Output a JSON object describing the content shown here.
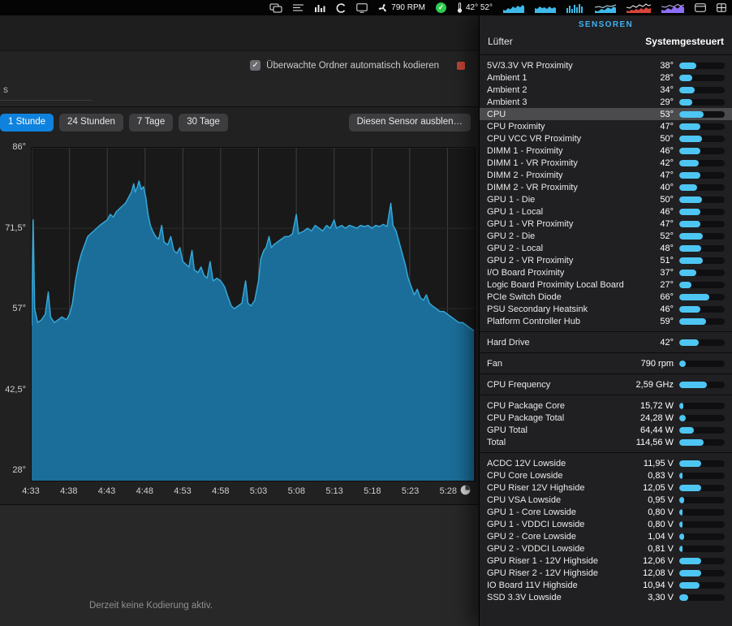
{
  "menubar": {
    "fan_rpm_label": "790 RPM",
    "temps_label": "42° 52°",
    "icons": [
      "displays-icon",
      "playlist-icon",
      "equalizer-icon",
      "c-app-icon",
      "display-icon",
      "fan-icon",
      "status-ok-icon",
      "thermometer-icon",
      "cpu-history-graph-icon",
      "gpu-history-graph-icon",
      "memory-history-graph-icon",
      "disk-history-graph-icon",
      "sensors-history-graph-icon",
      "network-history-graph-icon",
      "window-icon",
      "grid-icon"
    ]
  },
  "encoder_window": {
    "watch_checkbox_label": "Überwachte Ordner automatisch kodieren",
    "watch_checkbox_checked": true,
    "sidebar_stub": "s",
    "status_text": "Derzeit keine Kodierung aktiv.",
    "hide_sensor_button_label": "Diesen Sensor ausblen…",
    "range_tabs": [
      {
        "label": "1 Stunde",
        "selected": true
      },
      {
        "label": "24 Stunden",
        "selected": false
      },
      {
        "label": "7 Tage",
        "selected": false
      },
      {
        "label": "30 Tage",
        "selected": false
      }
    ]
  },
  "chart_data": {
    "type": "area",
    "sensor": "CPU",
    "unit": "°C",
    "y_range": [
      26,
      86
    ],
    "x_range_minutes": [
      0,
      58.6
    ],
    "grid": true,
    "y_ticks": [
      {
        "label": "86°",
        "value": 86
      },
      {
        "label": "71,5°",
        "value": 71.5
      },
      {
        "label": "57°",
        "value": 57
      },
      {
        "label": "42,5°",
        "value": 42.5
      },
      {
        "label": "28°",
        "value": 28
      }
    ],
    "x_ticks": [
      {
        "label": "4:33",
        "minute": 0
      },
      {
        "label": "4:38",
        "minute": 5
      },
      {
        "label": "4:43",
        "minute": 10
      },
      {
        "label": "4:48",
        "minute": 15
      },
      {
        "label": "4:53",
        "minute": 20
      },
      {
        "label": "4:58",
        "minute": 25
      },
      {
        "label": "5:03",
        "minute": 30
      },
      {
        "label": "5:08",
        "minute": 35
      },
      {
        "label": "5:13",
        "minute": 40
      },
      {
        "label": "5:18",
        "minute": 45
      },
      {
        "label": "5:23",
        "minute": 50
      },
      {
        "label": "5:28",
        "minute": 55
      }
    ],
    "points": [
      [
        0,
        54
      ],
      [
        0.2,
        73
      ],
      [
        0.4,
        57
      ],
      [
        0.8,
        54.5
      ],
      [
        1.3,
        55
      ],
      [
        1.8,
        56
      ],
      [
        2.2,
        60
      ],
      [
        2.5,
        55.5
      ],
      [
        3,
        54.5
      ],
      [
        3.5,
        55
      ],
      [
        4,
        55.5
      ],
      [
        4.6,
        55
      ],
      [
        5,
        56
      ],
      [
        5.4,
        58
      ],
      [
        5.8,
        62
      ],
      [
        6.2,
        65
      ],
      [
        6.6,
        67
      ],
      [
        7,
        68.5
      ],
      [
        7.4,
        70
      ],
      [
        7.8,
        70.5
      ],
      [
        8.2,
        71
      ],
      [
        8.6,
        71.5
      ],
      [
        9,
        72
      ],
      [
        9.5,
        72.5
      ],
      [
        10,
        73
      ],
      [
        10.4,
        74
      ],
      [
        10.8,
        73.5
      ],
      [
        11.2,
        74.5
      ],
      [
        11.6,
        75
      ],
      [
        12,
        75.5
      ],
      [
        12.4,
        76
      ],
      [
        12.8,
        77
      ],
      [
        13.2,
        78
      ],
      [
        13.5,
        79.5
      ],
      [
        13.7,
        78
      ],
      [
        14,
        79
      ],
      [
        14.2,
        80
      ],
      [
        14.5,
        78.5
      ],
      [
        14.8,
        79
      ],
      [
        15.1,
        77
      ],
      [
        15.4,
        74
      ],
      [
        15.7,
        72
      ],
      [
        16,
        71
      ],
      [
        16.4,
        70
      ],
      [
        16.8,
        69.5
      ],
      [
        17.2,
        72
      ],
      [
        17.5,
        69
      ],
      [
        18,
        68.5
      ],
      [
        18.4,
        70
      ],
      [
        18.8,
        67.5
      ],
      [
        19.2,
        67
      ],
      [
        19.6,
        68
      ],
      [
        20,
        65.5
      ],
      [
        20.4,
        65
      ],
      [
        20.8,
        64.5
      ],
      [
        21.2,
        67.5
      ],
      [
        21.5,
        64
      ],
      [
        22,
        63.5
      ],
      [
        22.4,
        64.5
      ],
      [
        22.8,
        63
      ],
      [
        23.2,
        62.5
      ],
      [
        23.6,
        65.5
      ],
      [
        24,
        62
      ],
      [
        24.5,
        62.5
      ],
      [
        25,
        62
      ],
      [
        25.5,
        61
      ],
      [
        26,
        59
      ],
      [
        26.4,
        57.5
      ],
      [
        26.8,
        57
      ],
      [
        27.3,
        57.5
      ],
      [
        27.8,
        58
      ],
      [
        28.3,
        62
      ],
      [
        28.6,
        58
      ],
      [
        29,
        57.5
      ],
      [
        29.5,
        58.5
      ],
      [
        30,
        62
      ],
      [
        30.3,
        66
      ],
      [
        30.7,
        67.5
      ],
      [
        31,
        68
      ],
      [
        31.4,
        70
      ],
      [
        31.7,
        68
      ],
      [
        32,
        68.5
      ],
      [
        32.5,
        69
      ],
      [
        33,
        69.5
      ],
      [
        33.5,
        70
      ],
      [
        34,
        70
      ],
      [
        34.5,
        70.5
      ],
      [
        35,
        74
      ],
      [
        35.3,
        70.5
      ],
      [
        36,
        71
      ],
      [
        36.5,
        71.5
      ],
      [
        37,
        71
      ],
      [
        37.5,
        72
      ],
      [
        38,
        71.5
      ],
      [
        38.5,
        71
      ],
      [
        39,
        72
      ],
      [
        39.5,
        71.5
      ],
      [
        40,
        73
      ],
      [
        40.3,
        71.5
      ],
      [
        41,
        72
      ],
      [
        41.5,
        71.5
      ],
      [
        42,
        72
      ],
      [
        42.5,
        71.8
      ],
      [
        43,
        71.5
      ],
      [
        43.5,
        72
      ],
      [
        44,
        71.8
      ],
      [
        44.5,
        72
      ],
      [
        45,
        71.5
      ],
      [
        45.5,
        72
      ],
      [
        46,
        71.8
      ],
      [
        46.5,
        72.2
      ],
      [
        47,
        71.8
      ],
      [
        47.5,
        76
      ],
      [
        47.8,
        72
      ],
      [
        48.2,
        71
      ],
      [
        48.6,
        69
      ],
      [
        49,
        67
      ],
      [
        49.4,
        65
      ],
      [
        49.8,
        62.5
      ],
      [
        50.2,
        61
      ],
      [
        50.6,
        59.5
      ],
      [
        51,
        60.5
      ],
      [
        51.4,
        59
      ],
      [
        51.8,
        58.5
      ],
      [
        52.2,
        59.5
      ],
      [
        52.6,
        58
      ],
      [
        53,
        57.5
      ],
      [
        53.5,
        57
      ],
      [
        54,
        56.5
      ],
      [
        54.5,
        56.5
      ],
      [
        55,
        56
      ],
      [
        55.5,
        55.5
      ],
      [
        56,
        55
      ],
      [
        56.5,
        54.5
      ],
      [
        57,
        54.5
      ],
      [
        57.5,
        54
      ],
      [
        58,
        53.5
      ],
      [
        58.5,
        53
      ]
    ]
  },
  "sensor_panel": {
    "title": "SENSOREN",
    "header": {
      "left": "Lüfter",
      "right": "Systemgesteuert"
    },
    "bar_color": "#4ec6f3",
    "title_color": "#41b1ef",
    "groups": [
      {
        "name": "temperatures",
        "rows": [
          {
            "label": "5V/3.3V VR Proximity",
            "value": "38°",
            "bar": 0.38
          },
          {
            "label": "Ambient 1",
            "value": "28°",
            "bar": 0.28
          },
          {
            "label": "Ambient 2",
            "value": "34°",
            "bar": 0.34
          },
          {
            "label": "Ambient 3",
            "value": "29°",
            "bar": 0.29
          },
          {
            "label": "CPU",
            "value": "53°",
            "bar": 0.53,
            "selected": true
          },
          {
            "label": "CPU Proximity",
            "value": "47°",
            "bar": 0.47
          },
          {
            "label": "CPU VCC VR Proximity",
            "value": "50°",
            "bar": 0.5
          },
          {
            "label": "DIMM 1 - Proximity",
            "value": "46°",
            "bar": 0.46
          },
          {
            "label": "DIMM 1 - VR Proximity",
            "value": "42°",
            "bar": 0.42
          },
          {
            "label": "DIMM 2 - Proximity",
            "value": "47°",
            "bar": 0.47
          },
          {
            "label": "DIMM 2 - VR Proximity",
            "value": "40°",
            "bar": 0.4
          },
          {
            "label": "GPU 1 - Die",
            "value": "50°",
            "bar": 0.5
          },
          {
            "label": "GPU 1 - Local",
            "value": "46°",
            "bar": 0.46
          },
          {
            "label": "GPU 1 - VR Proximity",
            "value": "47°",
            "bar": 0.47
          },
          {
            "label": "GPU 2 - Die",
            "value": "52°",
            "bar": 0.52
          },
          {
            "label": "GPU 2 - Local",
            "value": "48°",
            "bar": 0.48
          },
          {
            "label": "GPU 2 - VR Proximity",
            "value": "51°",
            "bar": 0.51
          },
          {
            "label": "I/O Board Proximity",
            "value": "37°",
            "bar": 0.37
          },
          {
            "label": "Logic Board Proximity Local Board",
            "value": "27°",
            "bar": 0.27
          },
          {
            "label": "PCIe Switch Diode",
            "value": "66°",
            "bar": 0.66
          },
          {
            "label": "PSU Secondary Heatsink",
            "value": "46°",
            "bar": 0.46
          },
          {
            "label": "Platform Controller Hub",
            "value": "59°",
            "bar": 0.59
          }
        ]
      },
      {
        "name": "hard-drive",
        "rows": [
          {
            "label": "Hard Drive",
            "value": "42°",
            "bar": 0.42
          }
        ]
      },
      {
        "name": "fan",
        "rows": [
          {
            "label": "Fan",
            "value": "790 rpm",
            "bar": 0.15
          }
        ]
      },
      {
        "name": "cpu-frequency",
        "rows": [
          {
            "label": "CPU Frequency",
            "value": "2,59 GHz",
            "bar": 0.6
          }
        ]
      },
      {
        "name": "power",
        "rows": [
          {
            "label": "CPU Package Core",
            "value": "15,72 W",
            "bar": 0.09
          },
          {
            "label": "CPU Package Total",
            "value": "24,28 W",
            "bar": 0.14
          },
          {
            "label": "GPU Total",
            "value": "64,44 W",
            "bar": 0.32
          },
          {
            "label": "Total",
            "value": "114,56 W",
            "bar": 0.53
          }
        ]
      },
      {
        "name": "voltage",
        "rows": [
          {
            "label": "ACDC 12V Lowside",
            "value": "11,95 V",
            "bar": 0.48
          },
          {
            "label": "CPU Core Lowside",
            "value": "0,83 V",
            "bar": 0.08
          },
          {
            "label": "CPU Riser 12V Highside",
            "value": "12,05 V",
            "bar": 0.48
          },
          {
            "label": "CPU VSA Lowside",
            "value": "0,95 V",
            "bar": 0.1
          },
          {
            "label": "GPU 1 - Core Lowside",
            "value": "0,80 V",
            "bar": 0.08
          },
          {
            "label": "GPU 1 - VDDCI Lowside",
            "value": "0,80 V",
            "bar": 0.08
          },
          {
            "label": "GPU 2 - Core Lowside",
            "value": "1,04 V",
            "bar": 0.11
          },
          {
            "label": "GPU 2 - VDDCI Lowside",
            "value": "0,81 V",
            "bar": 0.08
          },
          {
            "label": "GPU Riser 1 - 12V Highside",
            "value": "12,06 V",
            "bar": 0.48
          },
          {
            "label": "GPU Riser 2 - 12V Highside",
            "value": "12,08 V",
            "bar": 0.48
          },
          {
            "label": "IO Board 11V Highside",
            "value": "10,94 V",
            "bar": 0.44
          },
          {
            "label": "SSD 3.3V Lowside",
            "value": "3,30 V",
            "bar": 0.2
          }
        ]
      }
    ]
  }
}
